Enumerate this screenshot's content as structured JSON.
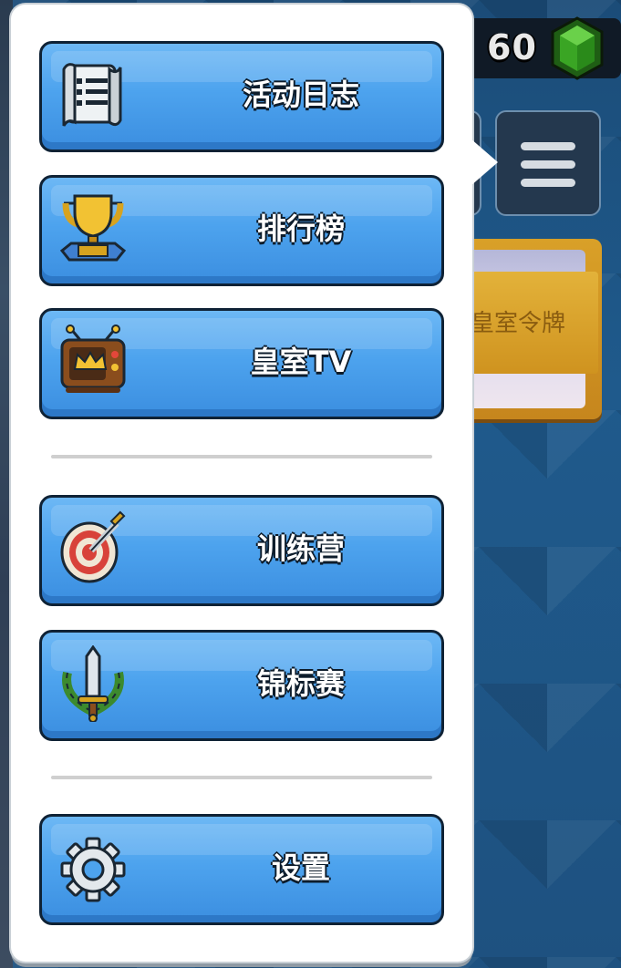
{
  "hud": {
    "gem_count": "60",
    "gem_icon": "green-gem-icon",
    "menu_icon": "hamburger-menu-icon"
  },
  "banner": {
    "label": "皇室令牌"
  },
  "menu": {
    "items": [
      {
        "label": "活动日志",
        "icon": "scroll-icon"
      },
      {
        "label": "排行榜",
        "icon": "trophy-icon"
      },
      {
        "label": "皇室TV",
        "icon": "tv-icon"
      },
      {
        "label": "训练营",
        "icon": "target-sword-icon"
      },
      {
        "label": "锦标赛",
        "icon": "laurel-sword-icon"
      },
      {
        "label": "设置",
        "icon": "gear-icon"
      }
    ]
  },
  "colors": {
    "button_blue": "#4da3ee",
    "button_border": "#0f2235",
    "popup_bg": "#ffffff",
    "gem_green": "#2e8f1e"
  }
}
